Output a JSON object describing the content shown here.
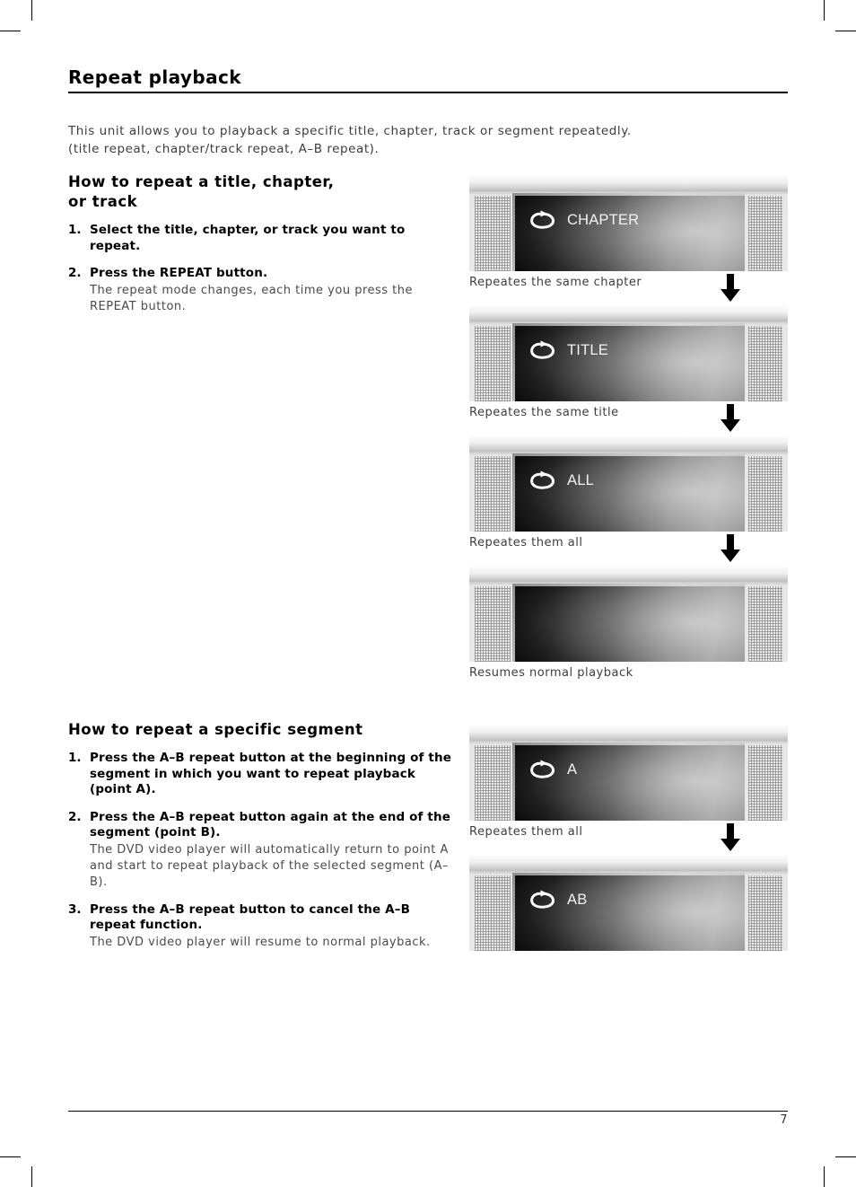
{
  "document": {
    "title": "Repeat playback",
    "page_number": "7",
    "intro_lines": [
      "This unit allows you to playback a specific title, chapter, track or segment repeatedly.",
      "(title repeat, chapter/track repeat, A–B repeat)."
    ]
  },
  "section_one": {
    "heading": "How to repeat a title, chapter,\nor track",
    "heading_line1": "How to repeat a title, chapter,",
    "heading_line2": "or track",
    "steps": [
      {
        "number": "1.",
        "head": "Select the title, chapter, or track you want to repeat.",
        "body": ""
      },
      {
        "number": "2.",
        "head": "Press the REPEAT button.",
        "body": "The repeat mode changes, each time you press the REPEAT button."
      }
    ],
    "figures": [
      {
        "icon": "repeat-loop-icon",
        "osd_label": "CHAPTER",
        "caption": "Repeates the same chapter",
        "has_arrow": true
      },
      {
        "icon": "repeat-loop-icon",
        "osd_label": "TITLE",
        "caption": "Repeates the same title",
        "has_arrow": true
      },
      {
        "icon": "repeat-loop-icon",
        "osd_label": "ALL",
        "caption": "Repeates them all",
        "has_arrow": true
      },
      {
        "icon": "",
        "osd_label": "",
        "caption": "Resumes normal playback",
        "has_arrow": false
      }
    ]
  },
  "section_two": {
    "heading": "How to repeat a specific segment",
    "steps": [
      {
        "number": "1.",
        "head": "Press the A–B repeat button at the beginning of the segment in which you want to repeat playback (point A).",
        "body": ""
      },
      {
        "number": "2.",
        "head": "Press the A–B repeat button again at the end of the segment (point B).",
        "body": "The DVD video player will automatically return to point A and start to repeat playback of the selected segment (A–B)."
      },
      {
        "number": "3.",
        "head": "Press the A–B repeat button to cancel the A–B repeat function.",
        "body": "The DVD video player will resume to normal playback."
      }
    ],
    "figures": [
      {
        "icon": "repeat-loop-icon",
        "osd_label": "A",
        "caption": "Repeates them all",
        "has_arrow": true
      },
      {
        "icon": "repeat-loop-icon",
        "osd_label": "AB",
        "caption": "",
        "has_arrow": false
      }
    ]
  },
  "colors": {
    "text": "#1a1a1a",
    "body_text": "#4a4a4a",
    "rule": "#000000",
    "screen_dark": "#000000",
    "osd_text": "#f2f2f2",
    "bezel": "#d8d8d8"
  }
}
